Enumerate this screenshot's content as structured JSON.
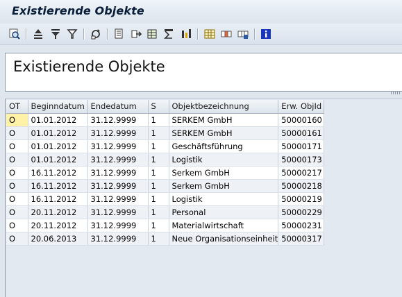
{
  "window": {
    "title": "Existierende Objekte"
  },
  "toolbar": {
    "buttons": [
      {
        "name": "details-icon"
      },
      {
        "name": "sort-ascending-icon"
      },
      {
        "name": "filter-icon"
      },
      {
        "name": "filter-set-icon"
      },
      {
        "name": "refresh-icon"
      },
      {
        "name": "print-preview-icon"
      },
      {
        "name": "export-icon"
      },
      {
        "name": "spreadsheet-icon"
      },
      {
        "name": "total-icon"
      },
      {
        "name": "subtotal-icon"
      },
      {
        "name": "layout-icon"
      },
      {
        "name": "change-layout-icon"
      },
      {
        "name": "save-layout-icon"
      },
      {
        "name": "information-icon"
      }
    ]
  },
  "header": {
    "text": "Existierende Objekte"
  },
  "table": {
    "columns": [
      "OT",
      "Beginndatum",
      "Endedatum",
      "S",
      "Objektbezeichnung",
      "Erw. ObjId"
    ],
    "rows": [
      [
        "O",
        "01.01.2012",
        "31.12.9999",
        "1",
        "SERKEM GmbH",
        "50000160"
      ],
      [
        "O",
        "01.01.2012",
        "31.12.9999",
        "1",
        "SERKEM GmbH",
        "50000161"
      ],
      [
        "O",
        "01.01.2012",
        "31.12.9999",
        "1",
        "Geschäftsführung",
        "50000171"
      ],
      [
        "O",
        "01.01.2012",
        "31.12.9999",
        "1",
        "Logistik",
        "50000173"
      ],
      [
        "O",
        "16.11.2012",
        "31.12.9999",
        "1",
        "Serkem GmbH",
        "50000217"
      ],
      [
        "O",
        "16.11.2012",
        "31.12.9999",
        "1",
        "Serkem GmbH",
        "50000218"
      ],
      [
        "O",
        "16.11.2012",
        "31.12.9999",
        "1",
        "Logistik",
        "50000219"
      ],
      [
        "O",
        "20.11.2012",
        "31.12.9999",
        "1",
        "Personal",
        "50000229"
      ],
      [
        "O",
        "20.11.2012",
        "31.12.9999",
        "1",
        "Materialwirtschaft",
        "50000231"
      ],
      [
        "O",
        "20.06.2013",
        "31.12.9999",
        "1",
        "Neue Organisationseinheit",
        "50000317"
      ]
    ],
    "selected_cell_color": "#fff2a6"
  },
  "colors": {
    "title": "#0a1e3a",
    "info_button": "#1a36b8"
  }
}
